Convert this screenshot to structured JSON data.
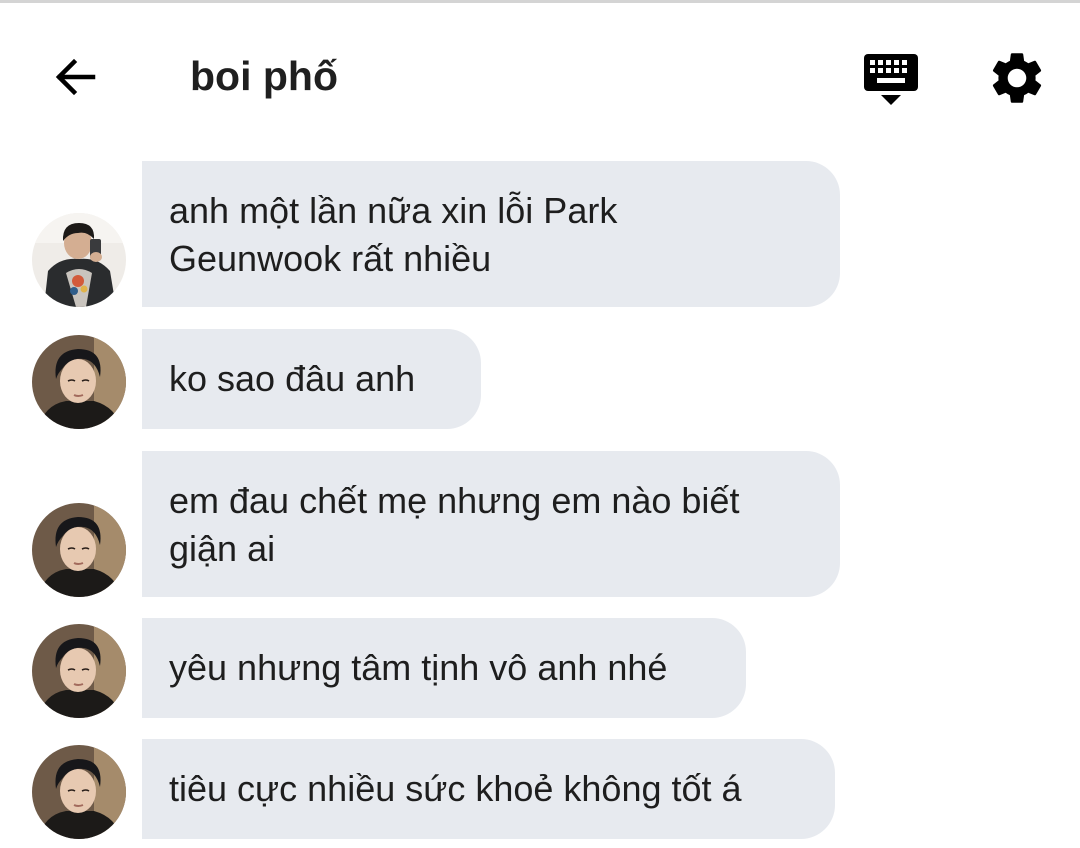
{
  "header": {
    "title": "boi phố",
    "back_icon": "arrow-left-icon",
    "keyboard_icon": "keyboard-hide-icon",
    "settings_icon": "gear-icon"
  },
  "messages": [
    {
      "lines": [
        "anh một lần nữa xin lỗi Park",
        "Geunwook rất nhiều"
      ],
      "avatar": "avatar-mirror-selfie"
    },
    {
      "lines": [
        "ko sao đâu anh"
      ],
      "avatar": "avatar-portrait"
    },
    {
      "lines": [
        "em đau chết mẹ nhưng em nào biết",
        "giận ai"
      ],
      "avatar": "avatar-portrait"
    },
    {
      "lines": [
        "yêu nhưng tâm tịnh vô anh nhé"
      ],
      "avatar": "avatar-portrait"
    },
    {
      "lines": [
        "tiêu cực nhiều sức khoẻ không tốt á"
      ],
      "avatar": "avatar-portrait"
    }
  ],
  "colors": {
    "bubble": "#e7eaef",
    "text": "#1e1e1e",
    "icon": "#000000",
    "background": "#ffffff"
  }
}
